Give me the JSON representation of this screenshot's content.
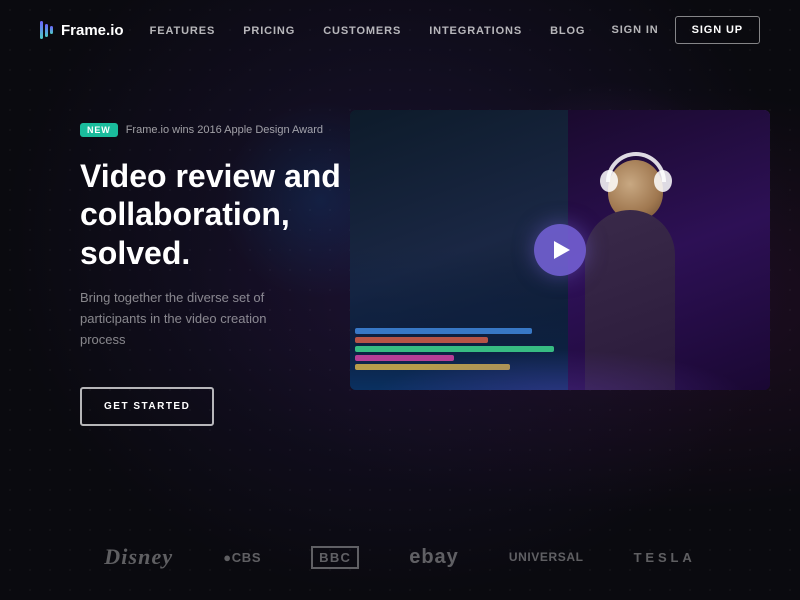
{
  "nav": {
    "logo": "Frame.io",
    "links": [
      {
        "id": "features",
        "label": "Features"
      },
      {
        "id": "pricing",
        "label": "Pricing"
      },
      {
        "id": "customers",
        "label": "Customers"
      },
      {
        "id": "integrations",
        "label": "Integrations"
      },
      {
        "id": "blog",
        "label": "Blog"
      }
    ],
    "signin_label": "Sign In",
    "signup_label": "Sign Up"
  },
  "hero": {
    "badge_new": "New",
    "badge_text": "Frame.io wins 2016 Apple Design Award",
    "title_line1": "Video review and",
    "title_line2": "collaboration, solved.",
    "subtitle": "Bring together the diverse set of participants in the video creation process",
    "cta": "Get Started"
  },
  "brands": [
    {
      "id": "disney",
      "label": "Disney",
      "class": "brand-disney"
    },
    {
      "id": "cbs",
      "label": "●CBS",
      "class": "brand-cbs"
    },
    {
      "id": "bbc",
      "label": "BBC",
      "class": "brand-bbc"
    },
    {
      "id": "ebay",
      "label": "ebay",
      "class": "brand-ebay"
    },
    {
      "id": "universal",
      "label": "UNIVERSAL",
      "class": "brand-universal"
    },
    {
      "id": "tesla",
      "label": "TESLA",
      "class": "brand-tesla"
    }
  ],
  "timeline": {
    "rows": [
      {
        "color": "#4a9eff",
        "width": "80%"
      },
      {
        "color": "#ff6b4a",
        "width": "60%"
      },
      {
        "color": "#4aff9e",
        "width": "90%"
      },
      {
        "color": "#ff4ab8",
        "width": "45%"
      },
      {
        "color": "#ffd04a",
        "width": "70%"
      }
    ]
  }
}
